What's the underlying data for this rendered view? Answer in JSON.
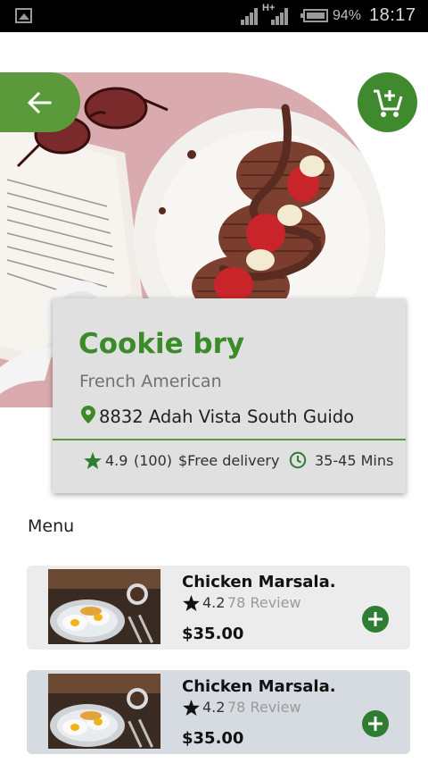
{
  "status_bar": {
    "network": "H+",
    "battery": "94%",
    "time": "18:17"
  },
  "restaurant": {
    "name": "Cookie bry",
    "cuisine": "French American",
    "address": "8832 Adah Vista South Guido",
    "rating": "4.9",
    "reviews_count": "(100)",
    "delivery": "$Free delivery",
    "delivery_time": "35-45 Mins"
  },
  "menu": {
    "title": "Menu",
    "items": [
      {
        "name": "Chicken Marsala.",
        "rating": "4.2",
        "reviews": "78 Review",
        "price": "$35.00"
      },
      {
        "name": "Chicken Marsala.",
        "rating": "4.2",
        "reviews": "78 Review",
        "price": "$35.00"
      }
    ]
  },
  "colors": {
    "accent_green": "#5a9a3b",
    "dark_green": "#3f8a2f",
    "title_green": "#3c8b2a",
    "card_bg": "#e0e0e0",
    "item1_bg": "#ececec",
    "item2_bg": "#d5dbe0"
  },
  "icons": {
    "back": "arrow-left-icon",
    "cart": "cart-add-icon",
    "location": "pin-icon",
    "rating": "star-icon",
    "time": "clock-icon",
    "add": "plus-circle-icon"
  }
}
